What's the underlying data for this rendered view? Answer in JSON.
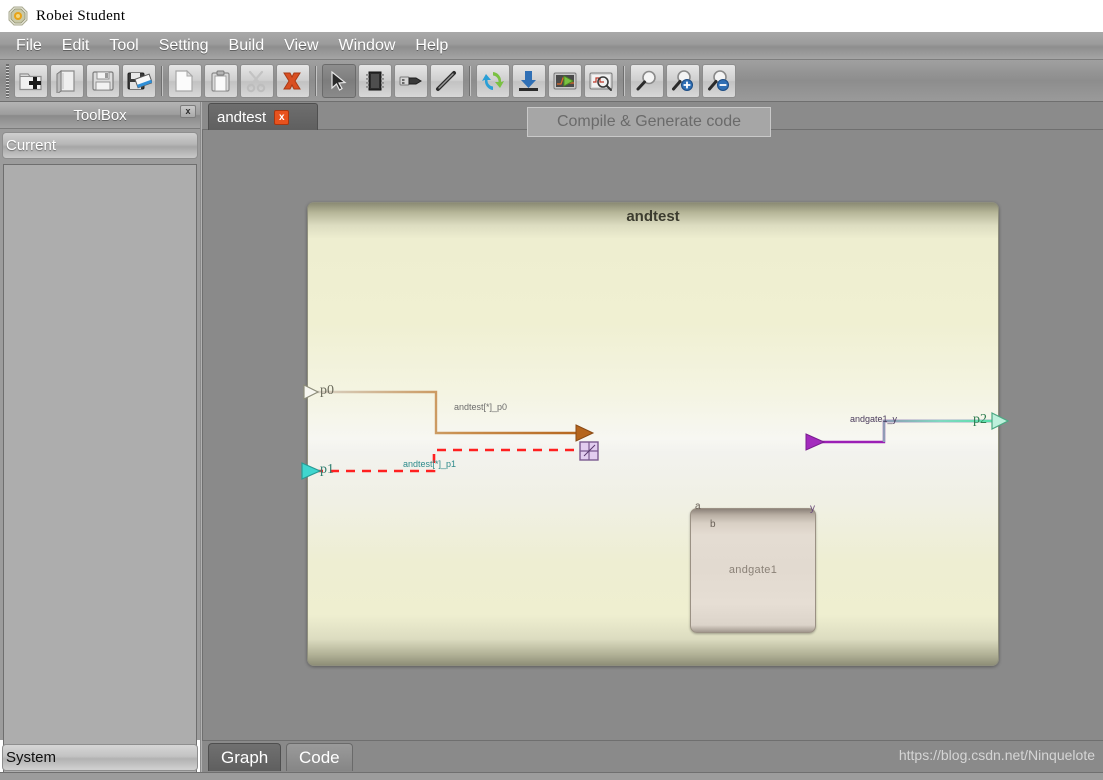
{
  "app": {
    "title": "Robei  Student",
    "logo_icon": "robei-hexagon-logo"
  },
  "menubar": {
    "items": [
      {
        "label": "File"
      },
      {
        "label": "Edit"
      },
      {
        "label": "Tool"
      },
      {
        "label": "Setting"
      },
      {
        "label": "Build"
      },
      {
        "label": "View"
      },
      {
        "label": "Window"
      },
      {
        "label": "Help"
      }
    ]
  },
  "toolbar": {
    "groups": [
      {
        "buttons": [
          {
            "name": "new-project-button",
            "icon": "folder-add-icon",
            "pressed": false
          },
          {
            "name": "open-module-button",
            "icon": "open-book-icon",
            "pressed": false
          },
          {
            "name": "save-button",
            "icon": "floppy-save-icon",
            "pressed": false
          },
          {
            "name": "save-as-button",
            "icon": "floppy-save-as-icon",
            "pressed": false
          }
        ]
      },
      {
        "buttons": [
          {
            "name": "copy-button",
            "icon": "copy-page-icon",
            "pressed": false
          },
          {
            "name": "paste-button",
            "icon": "clipboard-icon",
            "pressed": false
          },
          {
            "name": "cut-button",
            "icon": "scissors-icon",
            "pressed": false
          },
          {
            "name": "delete-button",
            "icon": "red-x-icon",
            "pressed": false
          }
        ]
      },
      {
        "buttons": [
          {
            "name": "select-tool-button",
            "icon": "cursor-arrow-icon",
            "pressed": true
          },
          {
            "name": "module-tool-button",
            "icon": "chip-icon",
            "pressed": false
          },
          {
            "name": "port-tool-button",
            "icon": "usb-plug-icon",
            "pressed": false
          },
          {
            "name": "wire-tool-button",
            "icon": "pencil-wire-icon",
            "pressed": false
          }
        ]
      },
      {
        "buttons": [
          {
            "name": "compile-generate-button",
            "icon": "refresh-cycle-icon",
            "pressed": false
          },
          {
            "name": "download-button",
            "icon": "download-arrow-icon",
            "pressed": false
          },
          {
            "name": "simulate-button",
            "icon": "play-screen-icon",
            "pressed": false
          },
          {
            "name": "waveform-button",
            "icon": "inspect-screen-icon",
            "pressed": false
          }
        ]
      },
      {
        "buttons": [
          {
            "name": "zoom-fit-button",
            "icon": "magnifier-icon",
            "pressed": false
          },
          {
            "name": "zoom-in-button",
            "icon": "magnifier-plus-icon",
            "pressed": false
          },
          {
            "name": "zoom-out-button",
            "icon": "magnifier-minus-icon",
            "pressed": false
          }
        ]
      }
    ]
  },
  "tooltip": {
    "text": "Compile & Generate code"
  },
  "toolbox": {
    "title": "ToolBox",
    "close_label": "x",
    "current_label": "Current"
  },
  "status": {
    "system_label": "System"
  },
  "document_tabs": [
    {
      "label": "andtest",
      "close_label": "x",
      "active": true
    }
  ],
  "view_tabs": [
    {
      "label": "Graph",
      "active": true
    },
    {
      "label": "Code",
      "active": false
    }
  ],
  "watermark": {
    "text": "https://blog.csdn.net/Ninquelote"
  },
  "diagram": {
    "module_title": "andtest",
    "sub_blocks": [
      {
        "name": "andgate1",
        "label": "andgate1",
        "ports": [
          {
            "name": "a",
            "label": "a",
            "direction": "in",
            "color": "#b5651d"
          },
          {
            "name": "b",
            "label": "b",
            "direction": "in",
            "color": "#c9a0dc",
            "selected": true
          },
          {
            "name": "y",
            "label": "y",
            "direction": "out",
            "color": "#9b1fb5"
          }
        ]
      }
    ],
    "external_ports": [
      {
        "name": "p0",
        "label": "p0",
        "direction": "in",
        "color": "#7a7a6a",
        "label_color": "#6b6b5c"
      },
      {
        "name": "p1",
        "label": "p1",
        "direction": "in",
        "color": "#3fd6cf",
        "label_color": "#2e7d6f"
      },
      {
        "name": "p2",
        "label": "p2",
        "direction": "out",
        "color": "#6fe3b8",
        "label_color": "#2e7d4f"
      }
    ],
    "wires": [
      {
        "name": "wire-p0-a",
        "label": "andtest[*]_p0",
        "color": "#b5651d",
        "style": "solid",
        "label_color": "#6d6d6d"
      },
      {
        "name": "wire-p1-b",
        "label": "andtest[*]_p1",
        "color": "#ff2020",
        "style": "dashed",
        "label_color": "#2e8b8b"
      },
      {
        "name": "wire-y-p2",
        "label": "andgate1_y",
        "color": "#9b1fb5",
        "style": "solid",
        "label_color": "#4a3b5c"
      }
    ]
  },
  "colors": {
    "chrome_gray": "#8e8e8e",
    "canvas_gray": "#8a8a8a",
    "module_cream": "#f0f0d2",
    "accent_orange": "#e8521e"
  }
}
